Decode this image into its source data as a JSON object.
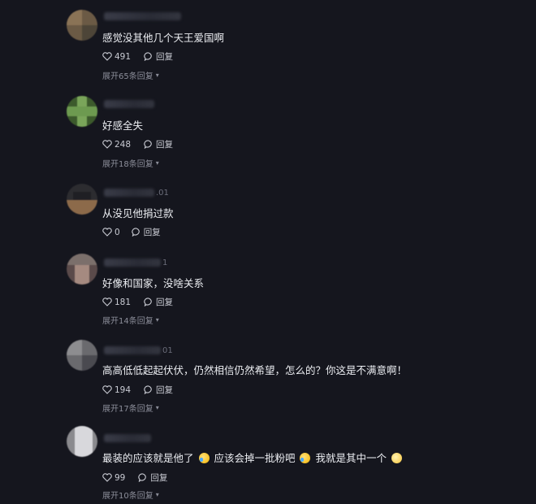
{
  "comments": [
    {
      "username_suffix": "",
      "text": "感觉没其他几个天王爱国啊",
      "likes": "491",
      "reply_label": "回复",
      "expand": "展开65条回复"
    },
    {
      "username_suffix": "",
      "text": "好感全失",
      "likes": "248",
      "reply_label": "回复",
      "expand": "展开18条回复"
    },
    {
      "username_suffix": ".01",
      "text": "从没见他捐过款",
      "likes": "0",
      "reply_label": "回复",
      "expand": ""
    },
    {
      "username_suffix": "1",
      "text": "好像和国家，没啥关系",
      "likes": "181",
      "reply_label": "回复",
      "expand": "展开14条回复"
    },
    {
      "username_suffix": "01",
      "text": "高高低低起起伏伏，仍然相信仍然希望，怎么的？你这是不满意啊！",
      "likes": "194",
      "reply_label": "回复",
      "expand": "展开17条回复"
    },
    {
      "username_suffix": "",
      "text_parts": [
        "最装的应该就是他了",
        "应该会掉一批粉吧",
        "我就是其中一个"
      ],
      "likes": "99",
      "reply_label": "回复",
      "expand": "展开10条回复"
    }
  ],
  "icons": {
    "like": "heart-icon",
    "reply": "comment-bubble-icon",
    "expand": "chevron-down-icon",
    "emoji_laugh_cry": "laugh-cry-emoji",
    "emoji_embarrassed": "embarrassed-emoji"
  }
}
